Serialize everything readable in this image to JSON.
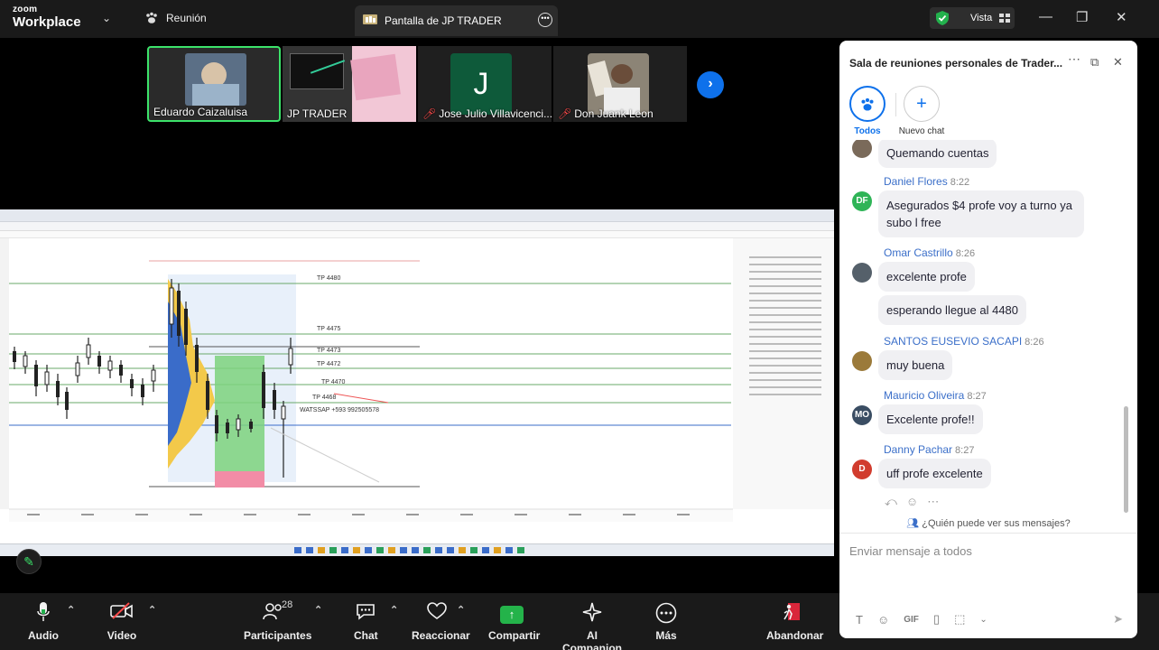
{
  "topbar": {
    "brand_line1": "zoom",
    "brand_line2": "Workplace",
    "meeting_label": "Reunión",
    "share_tab_title": "Pantalla de JP TRADER",
    "view_label": "Vista"
  },
  "participants_strip": [
    {
      "name": "Eduardo Caizaluisa",
      "muted": false,
      "active": true
    },
    {
      "name": "JP TRADER",
      "muted": false,
      "active": false
    },
    {
      "name": "Jose Julio Villavicenci...",
      "muted": true,
      "active": false,
      "initial": "J"
    },
    {
      "name": "Don Juank Leon",
      "muted": true,
      "active": false
    }
  ],
  "shared_chart": {
    "price_labels": [
      "TP 4480",
      "TP 4475",
      "TP 4473",
      "TP 4472",
      "TP 4470",
      "TP 4468"
    ],
    "contact_text": "WATSSAP +593 992505578"
  },
  "toolbar": {
    "audio": "Audio",
    "video": "Video",
    "participants": "Participantes",
    "participants_count": "28",
    "chat": "Chat",
    "react": "Reaccionar",
    "share": "Compartir",
    "companion": "AI Companion",
    "more": "Más",
    "leave": "Abandonar"
  },
  "chat": {
    "title": "Sala de reuniones personales de Trader...",
    "filters": [
      {
        "label": "Todos",
        "selected": true
      },
      {
        "label": "Nuevo chat",
        "selected": false
      }
    ],
    "messages": [
      {
        "sender": "",
        "time": "",
        "text": "Quemando cuentas",
        "avatar": "photo",
        "avatar_color": "#7a6a5a"
      },
      {
        "sender": "Daniel Flores",
        "time": "8:22",
        "text": "Asegurados $4 profe voy a turno ya subo l free",
        "avatar": "DF",
        "avatar_color": "#2fb457"
      },
      {
        "sender": "Omar Castrillo",
        "time": "8:26",
        "text": "excelente profe",
        "avatar": "photo",
        "avatar_color": "#55606a"
      },
      {
        "sender": "",
        "time": "",
        "text": "esperando llegue al 4480",
        "avatar": "",
        "avatar_color": ""
      },
      {
        "sender": "SANTOS EUSEVIO SACAPI",
        "time": "8:26",
        "text": "muy buena",
        "avatar": "photo",
        "avatar_color": "#9b7a3a"
      },
      {
        "sender": "Mauricio Oliveira",
        "time": "8:27",
        "text": "Excelente profe!!",
        "avatar": "MO",
        "avatar_color": "#3a4d63"
      },
      {
        "sender": "Danny Pachar",
        "time": "8:27",
        "text": "uff profe excelente",
        "avatar": "D",
        "avatar_color": "#d13c2e"
      }
    ],
    "who_can_see": "¿Quién puede ver sus mensajes?",
    "input_placeholder": "Enviar mensaje a todos",
    "gif_label": "GIF"
  }
}
